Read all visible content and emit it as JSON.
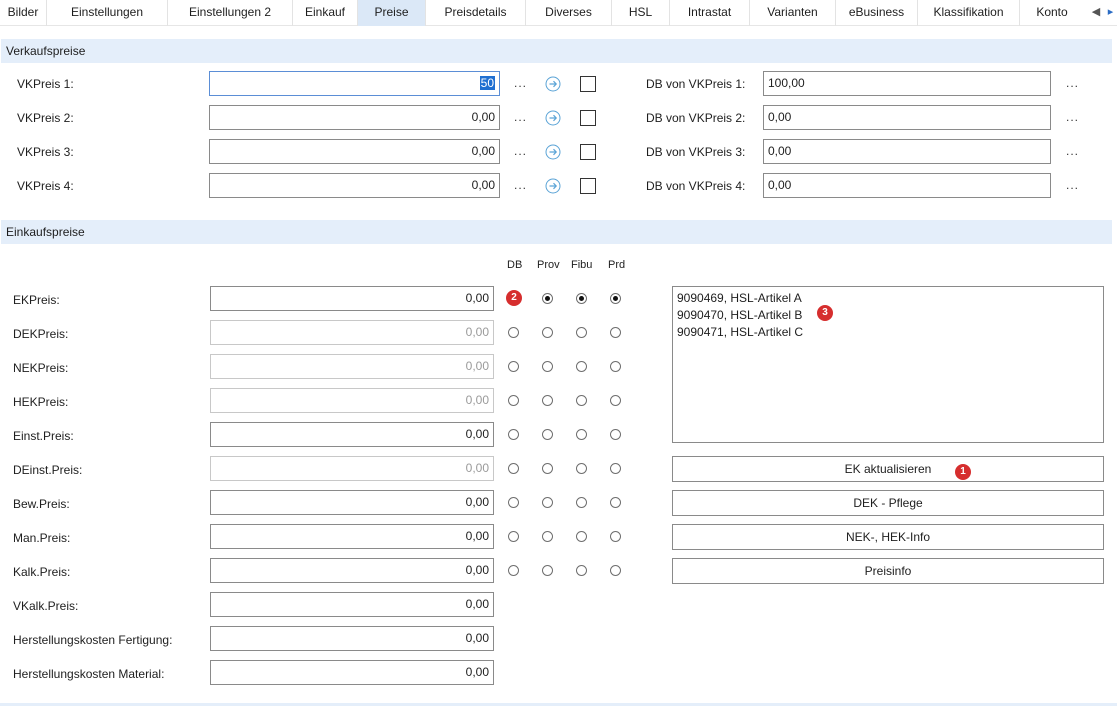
{
  "tabs": [
    "Bilder",
    "Einstellungen",
    "Einstellungen 2",
    "Einkauf",
    "Preise",
    "Preisdetails",
    "Diverses",
    "HSL",
    "Intrastat",
    "Varianten",
    "eBusiness",
    "Klassifikation",
    "Konto"
  ],
  "active_tab": "Preise",
  "colors": {
    "tab_active": "#dbe8f7",
    "section_bg": "#e4eefa",
    "badge": "#d62e2e",
    "focus_border": "#5b8ed6",
    "selection": "#1f6fd1"
  },
  "verkauf": {
    "title": "Verkaufspreise",
    "ellipsis": "...",
    "rows": [
      {
        "label": "VKPreis 1:",
        "value": "50",
        "db_label": "DB von VKPreis 1:",
        "db_value": "100,00"
      },
      {
        "label": "VKPreis 2:",
        "value": "0,00",
        "db_label": "DB von VKPreis 2:",
        "db_value": "0,00"
      },
      {
        "label": "VKPreis 3:",
        "value": "0,00",
        "db_label": "DB von VKPreis 3:",
        "db_value": "0,00"
      },
      {
        "label": "VKPreis 4:",
        "value": "0,00",
        "db_label": "DB von VKPreis 4:",
        "db_value": "0,00"
      }
    ]
  },
  "einkauf": {
    "title": "Einkaufspreise",
    "columns": [
      "DB",
      "Prov",
      "Fibu",
      "Prd"
    ],
    "rows": [
      {
        "label": "EKPreis:",
        "value": "0,00"
      },
      {
        "label": "DEKPreis:",
        "value": "0,00"
      },
      {
        "label": "NEKPreis:",
        "value": "0,00"
      },
      {
        "label": "HEKPreis:",
        "value": "0,00"
      },
      {
        "label": "Einst.Preis:",
        "value": "0,00"
      },
      {
        "label": "DEinst.Preis:",
        "value": "0,00"
      },
      {
        "label": "Bew.Preis:",
        "value": "0,00"
      },
      {
        "label": "Man.Preis:",
        "value": "0,00"
      },
      {
        "label": "Kalk.Preis:",
        "value": "0,00"
      },
      {
        "label": "VKalk.Preis:",
        "value": "0,00"
      },
      {
        "label": "Herstellungskosten Fertigung:",
        "value": "0,00"
      },
      {
        "label": "Herstellungskosten Material:",
        "value": "0,00"
      }
    ],
    "articles": [
      "9090469, HSL-Artikel A",
      "9090470, HSL-Artikel B",
      "9090471, HSL-Artikel C"
    ],
    "buttons": [
      "EK aktualisieren",
      "DEK - Pflege",
      "NEK-, HEK-Info",
      "Preisinfo"
    ]
  },
  "badges": [
    "1",
    "2",
    "3"
  ]
}
